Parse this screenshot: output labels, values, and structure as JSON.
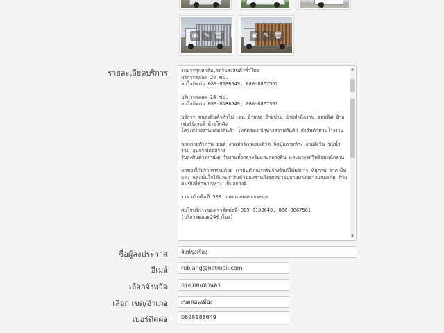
{
  "thumbnails_top": [
    {
      "name": "truck-photo-1"
    },
    {
      "name": "truck-photo-2"
    },
    {
      "name": "truck-photo-3"
    }
  ],
  "thumbnails": [
    {
      "name": "truck-photo-4",
      "icons": [
        "eye-icon",
        "pencil-icon",
        "trash-icon"
      ]
    },
    {
      "name": "truck-photo-5",
      "icons": [
        "eye-icon",
        "pencil-icon",
        "trash-icon"
      ]
    }
  ],
  "form": {
    "description_label": "รายละเอียดบริการ",
    "description_text": "รถบรรทุกหกล้อ,รถรับส่งสินค้าทั่วไทย\nบริการตลอด 24 ชม.\nสนใจติดต่อ 089-8188649, 086-8867561\n\nบริการตลอด 24 ชม.\nสนใจติดต่อ 089-8188649, 086-8867561\n\nบริการ ขนส่งสินค้าทั่วไป เช่น ย้ายหอ ย้ายบ้าน ย้ายสำนักงาน-ออฟฟิศ ย้ายเฟอร์นิเจอร์ ย้ายโกดัง\nโครงสร้างงานแสดงสินค้า โหลดของเข้าห้างสรรพสินค้า ส่งสินค้าตามโรงงาน\n\nฉากถ่ายทำภาพ ยนต์ งานทัวร์เทคอนเสิร์ต จัดบู๊ธตามห้าง งานอีเว้น ขนน้ำร่วม อุปกรณ์ก่อสร้าง\nรับส่งสินค้าทุกชนิด รับงานทั้งกลางวันและกลางคืน และทางรถวีพร้อมพนักงาน\n\nยกของไว้บริการท่านด้วย เรายินดีงานรถรับจ้างยินดีให้บริการ ที่สุภาพ ราคาไม่แพง และมั่นใจได้และว่าสินค้าของท่านถึงจุดหมายปลายทางอย่างปลอดภัย ด้วยคนขับที่ชำนาญทาง เป็นอย่างดี\n\nราคาเริ่มต้นที่ 500 บาทนอกพระยกระบุล\n\nสนใจบริการของเราติดต่อที่ 089 8188649, 086-8867561\n(บริการตลอด24ชั่วโมง)",
    "poster_label": "ชื่อผู้ลงประกาศ",
    "poster_value": "สิงห์รุ่งเรือง",
    "email_label": "อีเมล์",
    "email_value": "rubjang@hotmail.com",
    "province_label": "เลือกจังหวัด",
    "province_value": "กรุงเทพมหานคร",
    "district_label": "เลือก เขต/อำเภอ",
    "district_value": "เขตดอนเมือง",
    "phone_label": "เบอร์ติดต่อ",
    "phone_value": "0898188649"
  },
  "icons": {
    "eye": "◉",
    "pencil": "✎",
    "trash": "🗑",
    "scroll_up": "▲",
    "scroll_down": "▼"
  }
}
